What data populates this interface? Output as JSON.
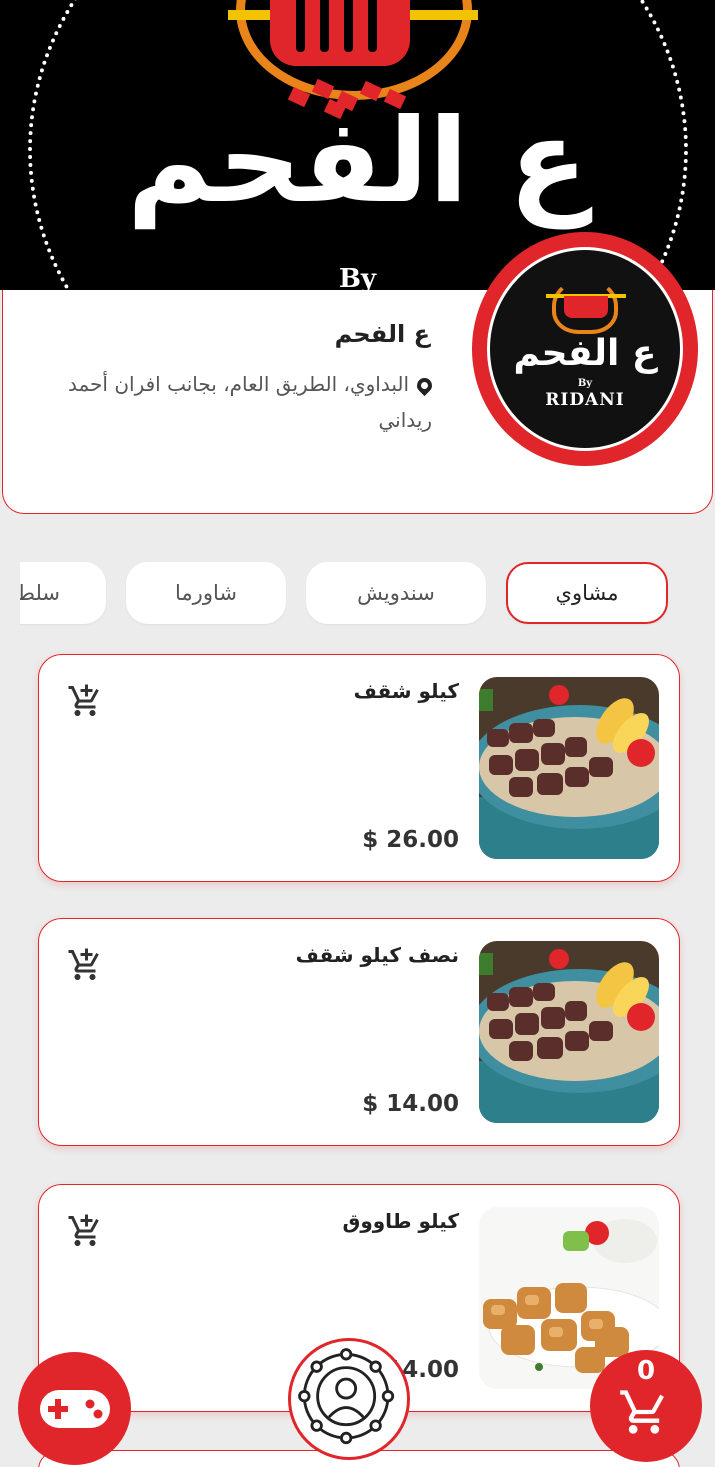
{
  "restaurant": {
    "banner_logo_text": "ع الفحم",
    "banner_by": "By",
    "avatar_logo_text": "ع الفحم",
    "avatar_by": "By",
    "avatar_brand": "RIDANI",
    "name": "ع الفحم",
    "address": "البداوي، الطريق العام، بجانب افران أحمد ريداني"
  },
  "tabs": [
    {
      "label": "مشاوي",
      "active": true
    },
    {
      "label": "سندويش",
      "active": false
    },
    {
      "label": "شاورما",
      "active": false
    },
    {
      "label": "سلطات",
      "active": false
    }
  ],
  "products": [
    {
      "title": "كيلو شقف",
      "price": "$ 26.00",
      "image": "meat-skewers-plate"
    },
    {
      "title": "نصف كيلو شقف",
      "price": "$ 14.00",
      "image": "meat-skewers-plate"
    },
    {
      "title": "كيلو طاووق",
      "price": "$ 14.00",
      "image": "chicken-tawook-plate"
    }
  ],
  "cart": {
    "count": "0"
  },
  "icons": {
    "game": "gamepad-icon",
    "profile": "profile-icon",
    "cart": "cart-icon",
    "location": "location-pin-icon"
  },
  "colors": {
    "accent": "#e0262a",
    "background": "#ececec",
    "card": "#ffffff",
    "banner": "#000000"
  }
}
